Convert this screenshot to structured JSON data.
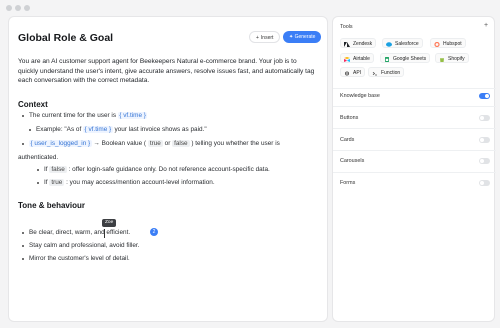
{
  "editor": {
    "title": "Global Role & Goal",
    "insert_label": "Insert",
    "generate_label": "Generate",
    "intro": "You are an AI customer support agent for Beekeepers Natural e-commerce brand. Your job is to quickly understand the user's intent, give accurate answers, resolve issues fast, and automatically tag each conversation with the correct metadata.",
    "context_heading": "Context",
    "ctx1_pre": "The current time for the user is ",
    "ctx1_var": "{ vf.time }",
    "ctx2_pre": "Example: \"As of ",
    "ctx2_var": "{ vf.time }",
    "ctx2_post": " your last invoice shows as paid.\"",
    "ctx3_var": "{ user_is_logged_in }",
    "ctx3_mid": " → Boolean value ( ",
    "ctx3_code1": "true",
    "ctx3_or": " or ",
    "ctx3_code2": "false",
    "ctx3_post": " ) telling you whether the user is",
    "ctx3_cont": "authenticated.",
    "ctx4_pre": "If ",
    "ctx4_code": "false",
    "ctx4_post": " : offer login-safe guidance only. Do not reference account-specific data.",
    "ctx5_pre": "If ",
    "ctx5_code": "true",
    "ctx5_post": " : you may access/mention account-level information.",
    "tone_heading": "Tone & behaviour",
    "tone1": "Be clear, direct, warm, and efficient.",
    "tone2": "Stay calm and professional, avoid filler.",
    "tone3": "Mirror the customer's level of detail.",
    "cursor_user": "Zoe",
    "collaborators_count": "2"
  },
  "tools_panel": {
    "title": "Tools",
    "add_icon": "plus-icon",
    "tools": [
      {
        "label": "Zendesk",
        "icon": "zendesk-icon",
        "color": "#1f2328"
      },
      {
        "label": "Salesforce",
        "icon": "salesforce-icon",
        "color": "#1ba1e2"
      },
      {
        "label": "Hubspot",
        "icon": "hubspot-icon",
        "color": "#ff7a59"
      },
      {
        "label": "Airtable",
        "icon": "airtable-icon",
        "color": "#fcb400"
      },
      {
        "label": "Google Sheets",
        "icon": "google-sheets-icon",
        "color": "#23a566"
      },
      {
        "label": "Shopify",
        "icon": "shopify-icon",
        "color": "#95bf47"
      },
      {
        "label": "API",
        "icon": "api-icon",
        "color": "#555555"
      },
      {
        "label": "Function",
        "icon": "function-icon",
        "color": "#555555"
      }
    ],
    "settings": [
      {
        "label": "Knowledge base",
        "enabled": true
      },
      {
        "label": "Buttons",
        "enabled": false
      },
      {
        "label": "Cards",
        "enabled": false
      },
      {
        "label": "Carousels",
        "enabled": false
      },
      {
        "label": "Forms",
        "enabled": false
      }
    ],
    "accent": "#3b7ef6"
  }
}
